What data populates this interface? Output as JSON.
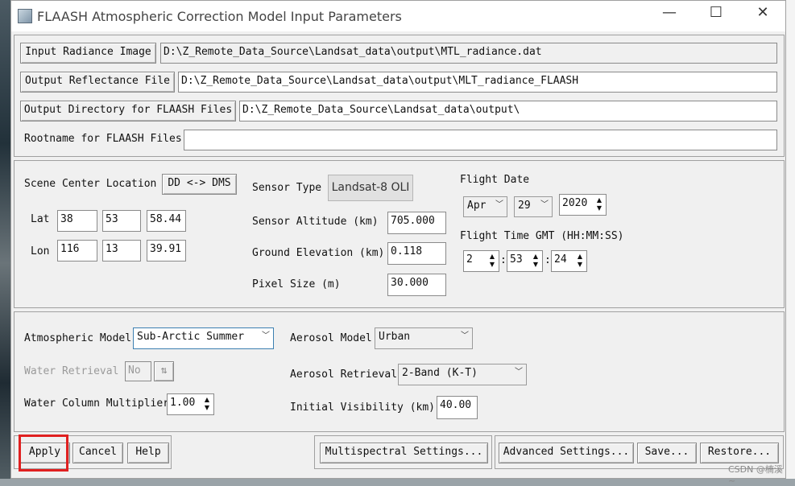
{
  "window": {
    "title": "FLAASH Atmospheric Correction Model Input Parameters",
    "minimize": "—",
    "maximize": "☐",
    "close": "✕"
  },
  "files": {
    "input_radiance_button": "Input Radiance Image",
    "input_radiance_value": "D:\\Z_Remote_Data_Source\\Landsat_data\\output\\MTL_radiance.dat",
    "output_reflectance_button": "Output Reflectance File",
    "output_reflectance_value": "D:\\Z_Remote_Data_Source\\Landsat_data\\output\\MLT_radiance_FLAASH",
    "output_dir_button": "Output Directory for FLAASH Files",
    "output_dir_value": "D:\\Z_Remote_Data_Source\\Landsat_data\\output\\",
    "rootname_label": "Rootname for FLAASH Files",
    "rootname_value": ""
  },
  "scene": {
    "center_label": "Scene Center Location",
    "dd_dms_button": "DD <-> DMS",
    "lat_label": "Lat",
    "lat": [
      "38",
      "53",
      "58.44"
    ],
    "lon_label": "Lon",
    "lon": [
      "116",
      "13",
      "39.91"
    ],
    "sensor_type_label": "Sensor Type",
    "sensor_type_value": "Landsat-8 OLI",
    "sensor_altitude_label": "Sensor Altitude (km)",
    "sensor_altitude_value": "705.000",
    "ground_elevation_label": "Ground Elevation (km)",
    "ground_elevation_value": "0.118",
    "pixel_size_label": "Pixel Size (m)",
    "pixel_size_value": "30.000",
    "flight_date_label": "Flight Date",
    "flight_month": "Apr",
    "flight_day": "29",
    "flight_year": "2020",
    "flight_time_label": "Flight Time GMT (HH:MM:SS)",
    "flight_hh": "2",
    "flight_mm": "53",
    "flight_ss": "24",
    "time_sep": ":"
  },
  "atmos": {
    "model_label": "Atmospheric Model",
    "model_value": "Sub-Arctic Summer",
    "aerosol_model_label": "Aerosol Model",
    "aerosol_model_value": "Urban",
    "water_retrieval_label": "Water Retrieval",
    "water_retrieval_value": "No",
    "aerosol_retrieval_label": "Aerosol Retrieval",
    "aerosol_retrieval_value": "2-Band (K-T)",
    "water_column_label": "Water Column Multiplier",
    "water_column_value": "1.00",
    "initial_visibility_label": "Initial Visibility (km)",
    "initial_visibility_value": "40.00"
  },
  "footer": {
    "apply": "Apply",
    "cancel": "Cancel",
    "help": "Help",
    "multispectral": "Multispectral Settings...",
    "advanced": "Advanced Settings...",
    "save": "Save...",
    "restore": "Restore..."
  },
  "watermark": "CSDN @楠溪~",
  "colors": {
    "highlight": "#e02020",
    "window_bg": "#f0f0f0"
  }
}
